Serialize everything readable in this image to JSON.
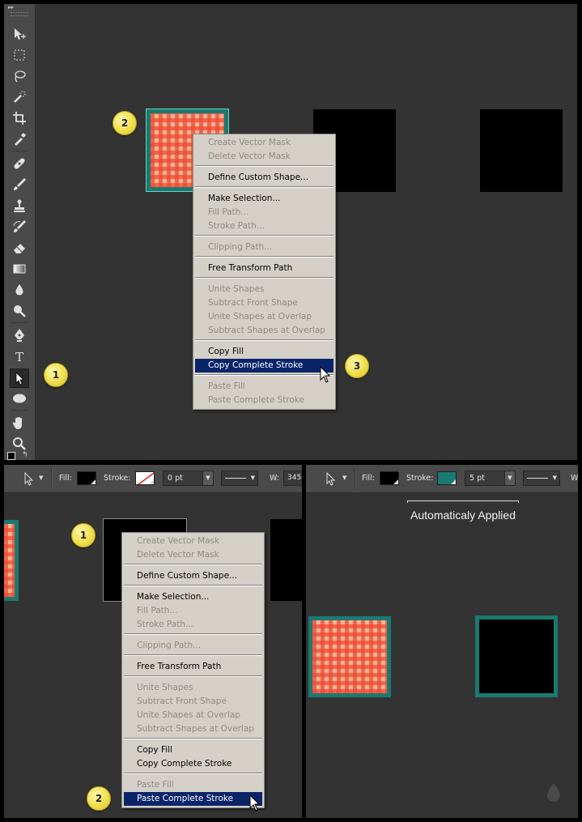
{
  "badges": {
    "one": "1",
    "two": "2",
    "three": "3"
  },
  "context_menu": {
    "items": [
      {
        "label": "Create Vector Mask",
        "enabled": false
      },
      {
        "label": "Delete Vector Mask",
        "enabled": false
      },
      {
        "label": "Define Custom Shape...",
        "enabled": true
      },
      {
        "label": "Make Selection...",
        "enabled": true
      },
      {
        "label": "Fill Path...",
        "enabled": false
      },
      {
        "label": "Stroke Path...",
        "enabled": false
      },
      {
        "label": "Clipping Path...",
        "enabled": false
      },
      {
        "label": "Free Transform Path",
        "enabled": true
      },
      {
        "label": "Unite Shapes",
        "enabled": false
      },
      {
        "label": "Subtract Front Shape",
        "enabled": false
      },
      {
        "label": "Unite Shapes at Overlap",
        "enabled": false
      },
      {
        "label": "Subtract Shapes at Overlap",
        "enabled": false
      },
      {
        "label": "Copy Fill",
        "enabled": true
      },
      {
        "label": "Copy Complete Stroke",
        "enabled": true
      },
      {
        "label": "Paste Fill",
        "enabled": false
      },
      {
        "label": "Paste Complete Stroke",
        "enabled": false
      }
    ]
  },
  "menu2": {
    "paste_complete_stroke_label": "Paste Complete Stroke",
    "paste_complete_stroke_enabled": true
  },
  "options_bar_left": {
    "fill_label": "Fill:",
    "stroke_label": "Stroke:",
    "stroke_width": "0 pt",
    "w_label": "W:",
    "w_value": "345"
  },
  "options_bar_right": {
    "fill_label": "Fill:",
    "stroke_label": "Stroke:",
    "stroke_width": "5 pt",
    "stroke_color": "#1a7a72",
    "w_label": "W"
  },
  "annotation": {
    "text": "Automaticaly Applied"
  },
  "colors": {
    "canvas": "#333333",
    "panel": "#4a4a4a",
    "stroke_teal": "#1a7a72",
    "menu_bg": "#d4d0c8",
    "menu_highlight": "#0a246a"
  },
  "toolbox": {
    "tools": [
      "move-tool",
      "marquee-tool",
      "lasso-tool",
      "quick-selection-tool",
      "crop-tool",
      "eyedropper-tool",
      "healing-brush-tool",
      "brush-tool",
      "clone-stamp-tool",
      "history-brush-tool",
      "eraser-tool",
      "gradient-tool",
      "blur-tool",
      "dodge-tool",
      "pen-tool",
      "type-tool",
      "path-selection-tool",
      "ellipse-tool",
      "hand-tool",
      "zoom-tool"
    ],
    "active": "path-selection-tool"
  }
}
